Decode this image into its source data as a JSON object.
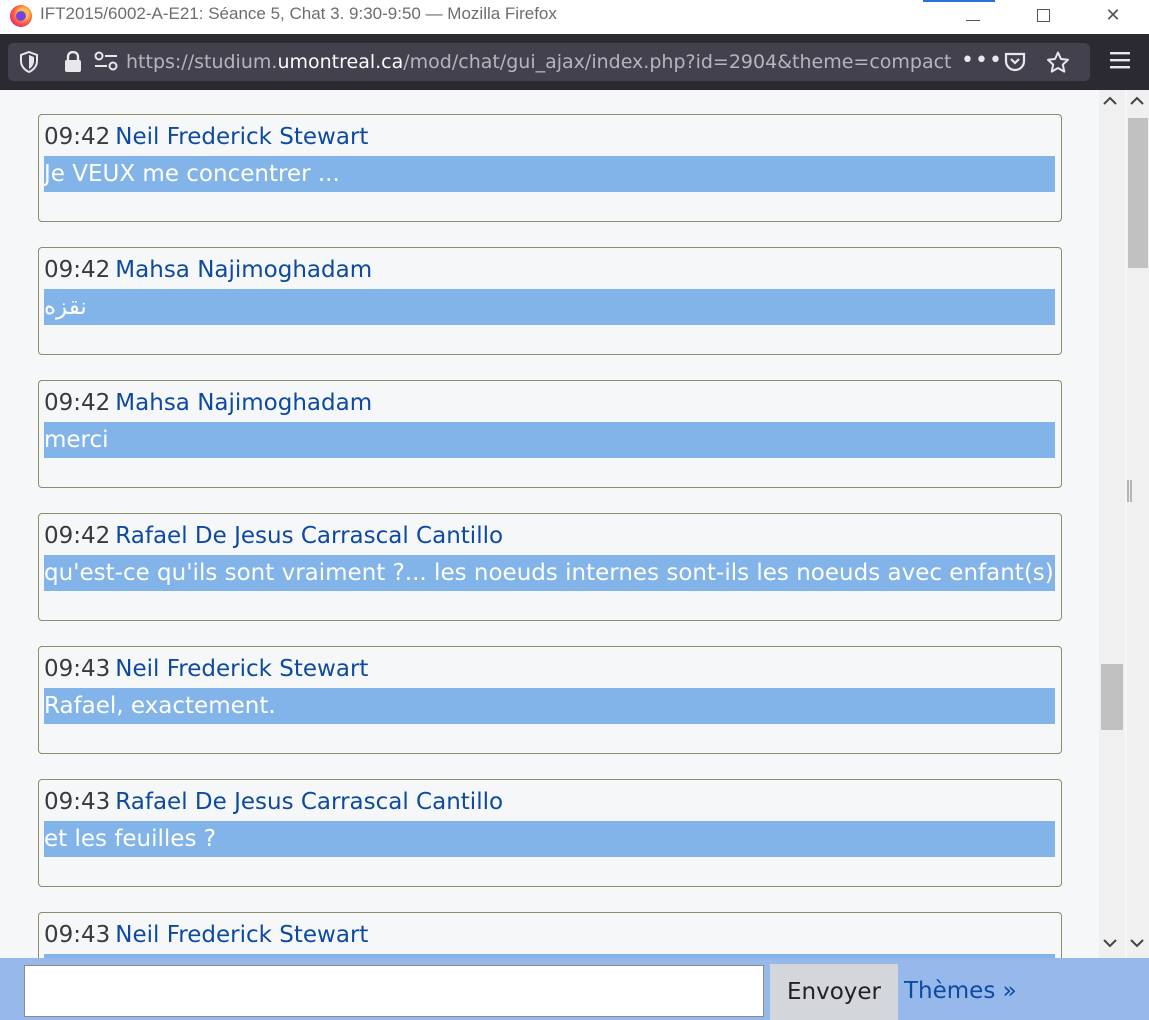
{
  "window": {
    "title": "IFT2015/6002-A-E21: Séance 5, Chat 3. 9:30-9:50 — Mozilla Firefox",
    "controls": {
      "minimize": "",
      "maximize": "",
      "close": "✕"
    }
  },
  "toolbar": {
    "url_prefix": "https://studium.",
    "url_domain": "umontreal.ca",
    "url_suffix": "/mod/chat/gui_ajax/index.php?id=2904&theme=compact",
    "more_label": "•••"
  },
  "messages": [
    {
      "time": "09:42",
      "user": "Neil Frederick Stewart",
      "text": "Je VEUX me concentrer ..."
    },
    {
      "time": "09:42",
      "user": "Mahsa Najimoghadam",
      "text": "نقزه"
    },
    {
      "time": "09:42",
      "user": "Mahsa Najimoghadam",
      "text": "merci"
    },
    {
      "time": "09:42",
      "user": "Rafael De Jesus Carrascal Cantillo",
      "text": "qu'est-ce qu'ils sont vraiment ?... les noeuds internes sont-ils les noeuds avec enfant(s) ?"
    },
    {
      "time": "09:43",
      "user": "Neil Frederick Stewart",
      "text": "Rafael, exactement."
    },
    {
      "time": "09:43",
      "user": "Rafael De Jesus Carrascal Cantillo",
      "text": "et les feuilles ?"
    },
    {
      "time": "09:43",
      "user": "Neil Frederick Stewart",
      "text": ""
    }
  ],
  "scrollbars": {
    "up_arrow": "^",
    "down_arrow": "v",
    "grip": "||"
  },
  "input": {
    "value": "",
    "placeholder": ""
  },
  "send_button_label": "Envoyer",
  "themes_link_label": "Thèmes »",
  "colors": {
    "message_bg": "#82b4ea",
    "user_link": "#0d4aa0",
    "inputbar": "#96b8ea",
    "toolbar": "#2b2a33"
  }
}
